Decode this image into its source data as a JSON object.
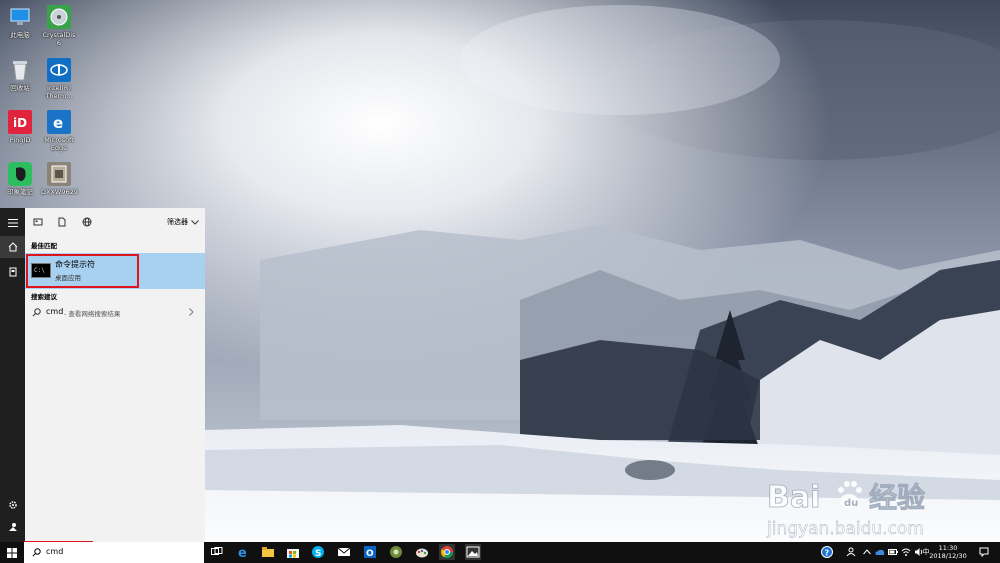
{
  "desktop": {
    "icons": [
      {
        "label": "此电脑",
        "icon": "computer-icon"
      },
      {
        "label": "CrystalDis\n6",
        "icon": "crystaldisk-icon"
      },
      {
        "label": "回收站",
        "icon": "recycle-bin-icon"
      },
      {
        "label": "Intel(R)\nTherm...",
        "icon": "intel-thermal-icon"
      },
      {
        "label": "PingID",
        "icon": "pingid-icon"
      },
      {
        "label": "Microsoft\nEdge",
        "icon": "edge-icon"
      },
      {
        "label": "印象笔记",
        "icon": "evernote-icon"
      },
      {
        "label": "DXXW9629",
        "icon": "file-icon"
      }
    ]
  },
  "start_menu": {
    "filter_label": "筛选器",
    "best_match_header": "最佳匹配",
    "best_match": {
      "title": "命令提示符",
      "subtitle": "桌面应用",
      "icon": "cmd-icon"
    },
    "suggestions_header": "搜索建议",
    "suggestion": {
      "term": "cmd",
      "hint": "- 查看网络搜索结果"
    }
  },
  "taskbar": {
    "search_value": "cmd",
    "apps": [
      "task-view-icon",
      "edge-icon",
      "file-explorer-icon",
      "store-icon",
      "skype-icon",
      "mail-icon",
      "outlook-icon",
      "app-icon",
      "paint-icon",
      "chrome-icon",
      "photos-icon"
    ],
    "clock_time": "11:30",
    "clock_date": "2018/12/30",
    "ime_label": "中"
  },
  "watermark": {
    "brand": "Baidu经验",
    "url": "jingyan.baidu.com"
  },
  "colors": {
    "highlight": "#e0141e",
    "selection": "#a8d0f0",
    "taskbar": "#101010",
    "rail": "#1f1f1f"
  }
}
